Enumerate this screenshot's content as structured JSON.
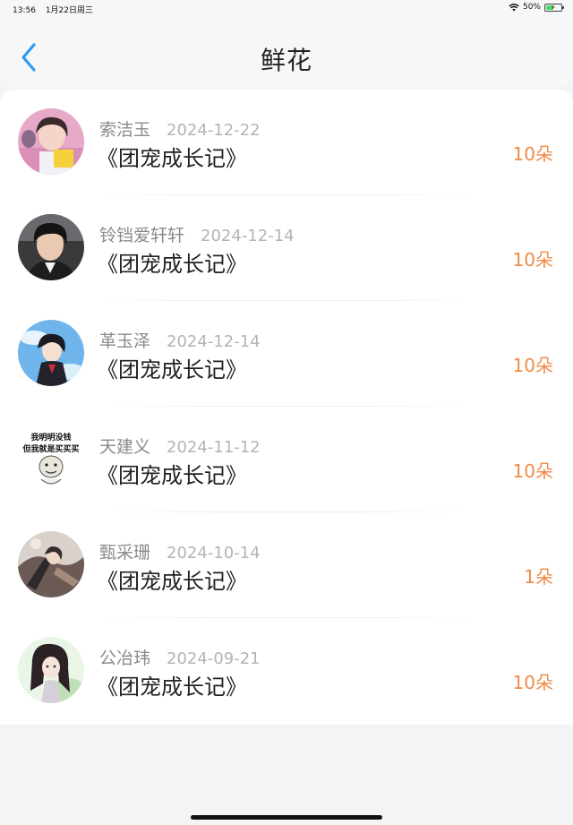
{
  "status_bar": {
    "time": "13:56",
    "date": "1月22日周三",
    "battery_percent": "50%",
    "battery_level": 0.5
  },
  "header": {
    "title": "鲜花"
  },
  "gifts": [
    {
      "name": "索洁玉",
      "date": "2024-12-22",
      "book": "《团宠成长记》",
      "amount": "10朵",
      "avatar": "photo-girl-pink"
    },
    {
      "name": "铃铛爱轩轩",
      "date": "2024-12-14",
      "book": "《团宠成长记》",
      "amount": "10朵",
      "avatar": "photo-short-hair"
    },
    {
      "name": "革玉泽",
      "date": "2024-12-14",
      "book": "《团宠成长记》",
      "amount": "10朵",
      "avatar": "anime-sky"
    },
    {
      "name": "天建义",
      "date": "2024-11-12",
      "book": "《团宠成长记》",
      "amount": "10朵",
      "avatar": "meme-face",
      "avatar_text": [
        "我明明没钱",
        "但我就是买买买"
      ]
    },
    {
      "name": "甄采珊",
      "date": "2024-10-14",
      "book": "《团宠成长记》",
      "amount": "1朵",
      "avatar": "anime-warrior"
    },
    {
      "name": "公冶玮",
      "date": "2024-09-21",
      "book": "《团宠成长记》",
      "amount": "10朵",
      "avatar": "anime-girl-green"
    }
  ]
}
